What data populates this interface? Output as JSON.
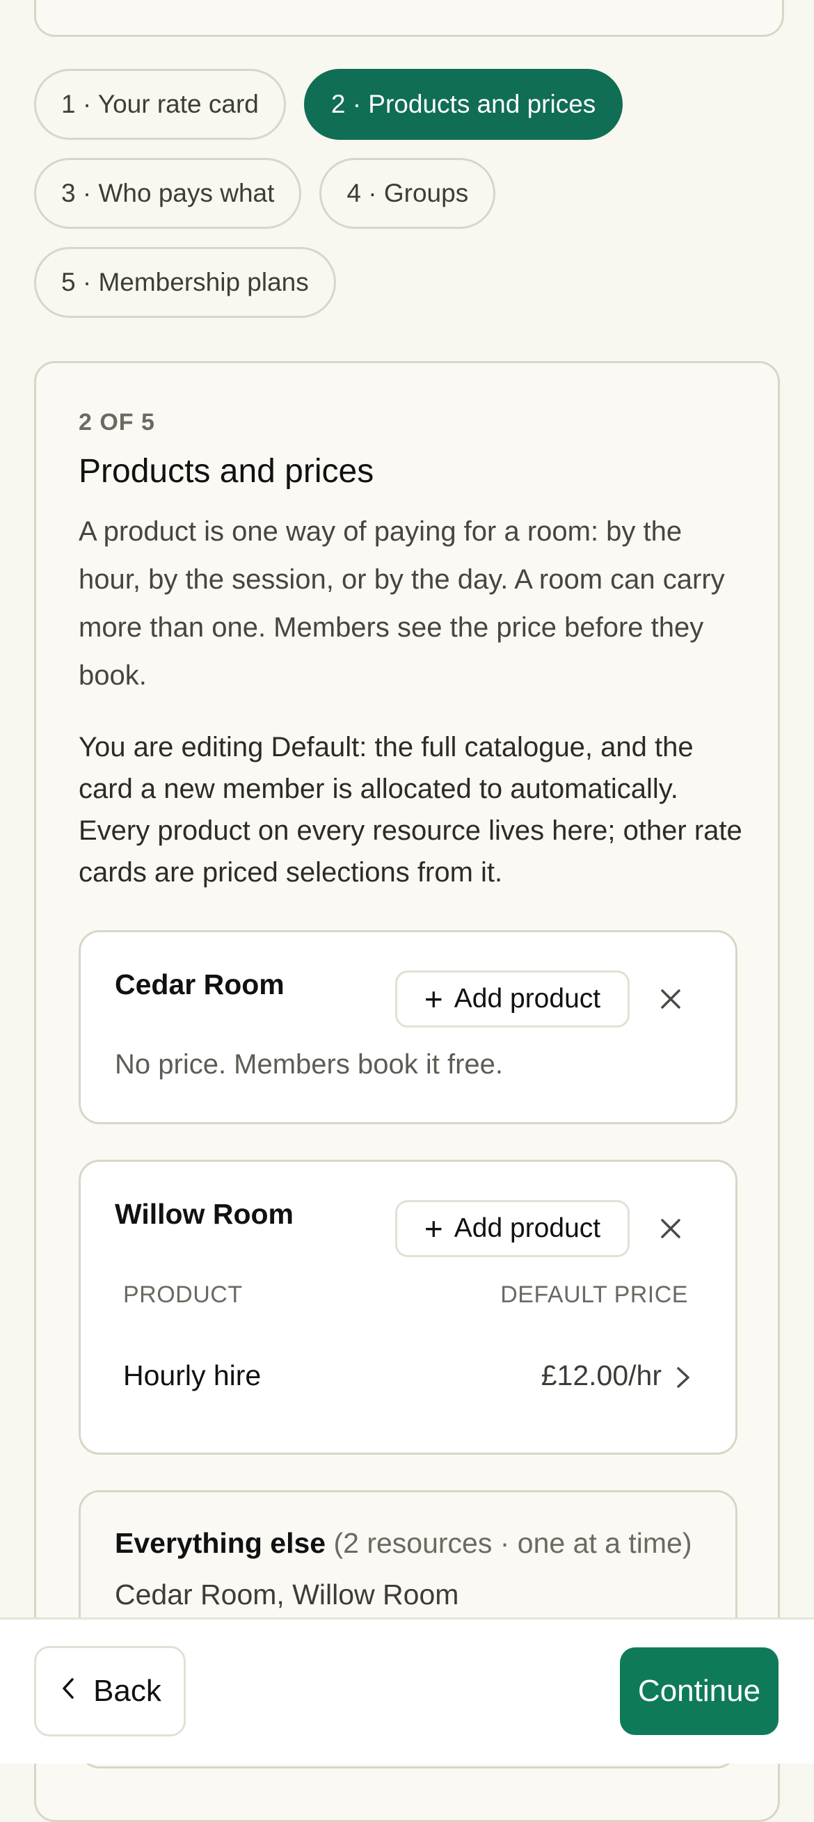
{
  "steps": [
    {
      "label": "1 · Your rate card",
      "active": false
    },
    {
      "label": "2 · Products and prices",
      "active": true
    },
    {
      "label": "3 · Who pays what",
      "active": false
    },
    {
      "label": "4 · Groups",
      "active": false
    },
    {
      "label": "5 · Membership plans",
      "active": false
    }
  ],
  "section": {
    "eyebrow": "2 OF 5",
    "title": "Products and prices",
    "intro": "A product is one way of paying for a room: by the hour, by the session, or by the day. A room can carry more than one. Members see the price before they book.",
    "editing_note": "You are editing Default: the full catalogue, and the card a new member is allocated to automatically. Every product on every resource lives here; other rate cards are priced selections from it."
  },
  "resources": [
    {
      "name": "Cedar Room",
      "add_label": "Add product",
      "empty_text": "No price. Members book it free."
    },
    {
      "name": "Willow Room",
      "add_label": "Add product",
      "columns": {
        "product": "PRODUCT",
        "price": "DEFAULT PRICE"
      },
      "products": [
        {
          "name": "Hourly hire",
          "price": "£12.00/hr"
        }
      ]
    }
  ],
  "everything_else": {
    "title": "Everything else",
    "meta": "(2 resources · one at a time)",
    "list": "Cedar Room, Willow Room"
  },
  "footer": {
    "back_label": "Back",
    "continue_label": "Continue"
  },
  "colors": {
    "accent": "#106e55",
    "background": "#f8f7f0",
    "border": "#d9d6c8"
  },
  "icons": [
    "plus-icon",
    "close-icon",
    "chevron-right-icon",
    "chevron-left-icon"
  ]
}
